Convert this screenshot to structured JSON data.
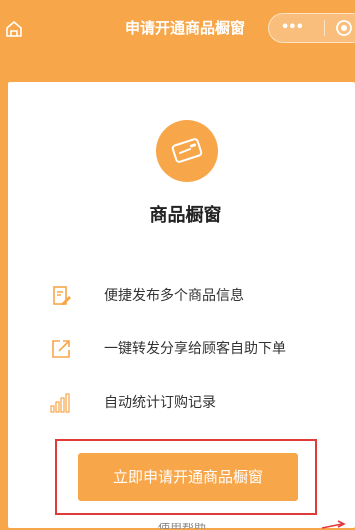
{
  "nav": {
    "title": "申请开通商品橱窗",
    "more_label": "•••",
    "home_icon": "home-icon",
    "close_icon": "target-close-icon"
  },
  "card": {
    "badge_icon": "card-icon",
    "title": "商品橱窗",
    "features": [
      {
        "icon": "edit-doc-icon",
        "label": "便捷发布多个商品信息"
      },
      {
        "icon": "share-external-icon",
        "label": "一键转发分享给顾客自助下单"
      },
      {
        "icon": "bar-chart-icon",
        "label": "自动统计订购记录"
      }
    ],
    "cta_label": "立即申请开通商品橱窗",
    "footer_link": "使用帮助"
  },
  "colors": {
    "brand_orange": "#f8a64a",
    "highlight_red": "#e03a3a",
    "text_dark": "#222222"
  }
}
